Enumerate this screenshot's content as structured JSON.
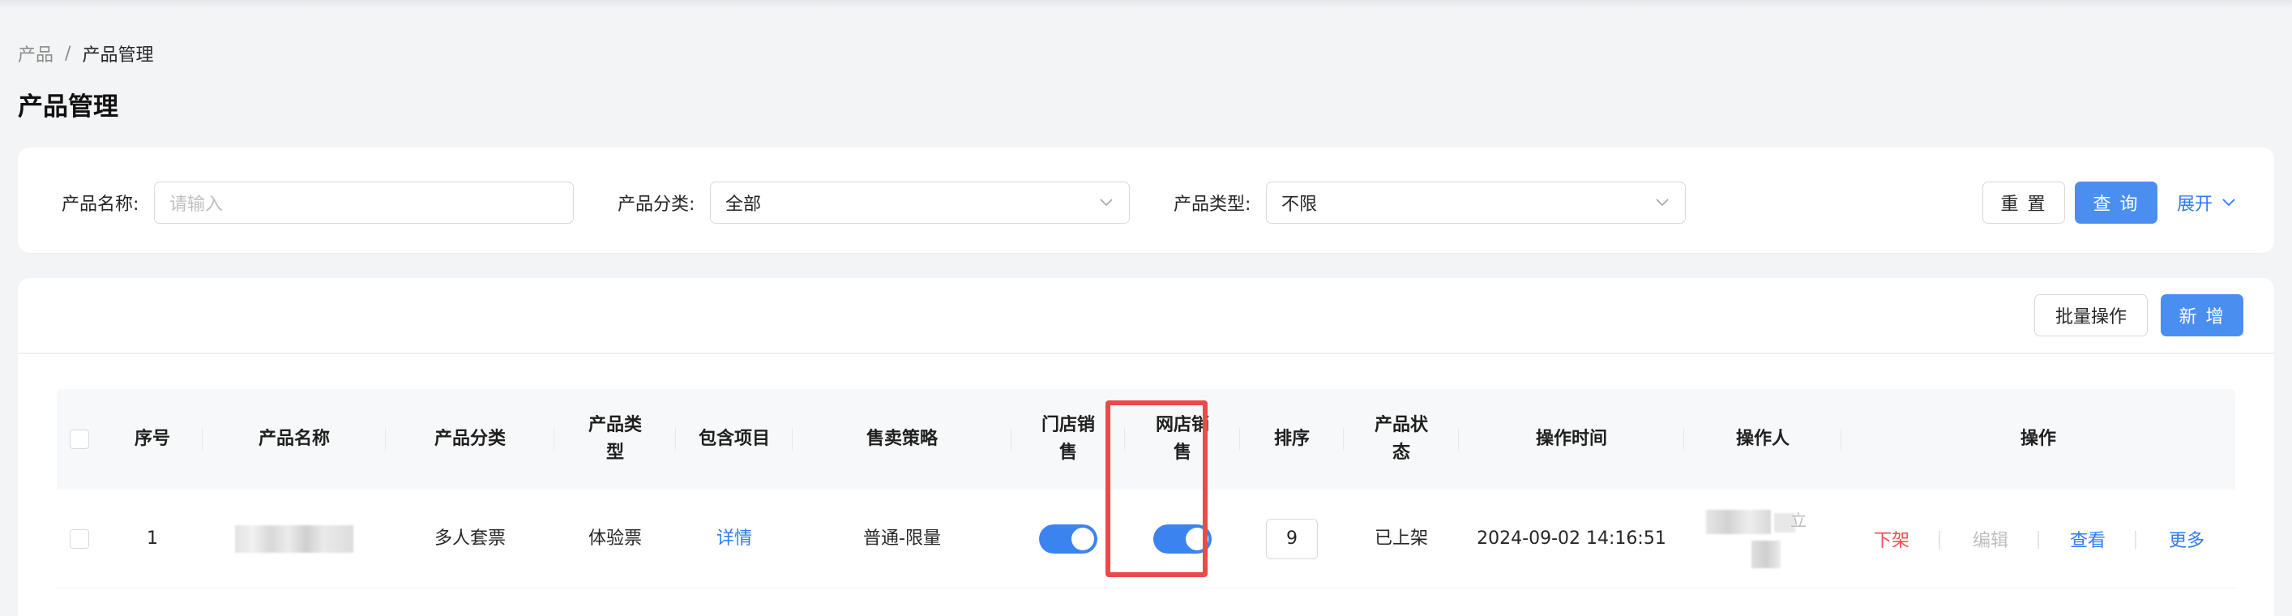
{
  "breadcrumb": {
    "parent": "产品",
    "separator": "/",
    "current": "产品管理"
  },
  "page": {
    "title": "产品管理"
  },
  "filters": {
    "name_label": "产品名称:",
    "name_placeholder": "请输入",
    "category_label": "产品分类:",
    "category_value": "全部",
    "type_label": "产品类型:",
    "type_value": "不限",
    "reset_label": "重 置",
    "query_label": "查 询",
    "expand_label": "展开"
  },
  "toolbar": {
    "batch_label": "批量操作",
    "add_label": "新 增"
  },
  "table": {
    "headers": {
      "index": "序号",
      "name": "产品名称",
      "category": "产品分类",
      "type": "产品类\n型",
      "items": "包含项目",
      "strategy": "售卖策略",
      "store_sale": "门店销\n售",
      "online_sale": "网店销\n售",
      "sort": "排序",
      "status": "产品状\n态",
      "op_time": "操作时间",
      "operator": "操作人",
      "actions": "操作"
    },
    "rows": [
      {
        "index": "1",
        "name": "",
        "category": "多人套票",
        "type": "体验票",
        "items": "详情",
        "strategy": "普通-限量",
        "store_sale_on": true,
        "online_sale_on": true,
        "sort": "9",
        "status": "已上架",
        "op_time": "2024-09-02 14:16:51",
        "operator_partial": "立",
        "actions": {
          "offline": "下架",
          "edit": "编辑",
          "view": "查看",
          "more": "更多"
        }
      }
    ]
  },
  "colors": {
    "primary": "#4a8ff0",
    "link": "#2f7bf0",
    "danger": "#ef4d4d",
    "highlight": "#ec4a4a"
  }
}
